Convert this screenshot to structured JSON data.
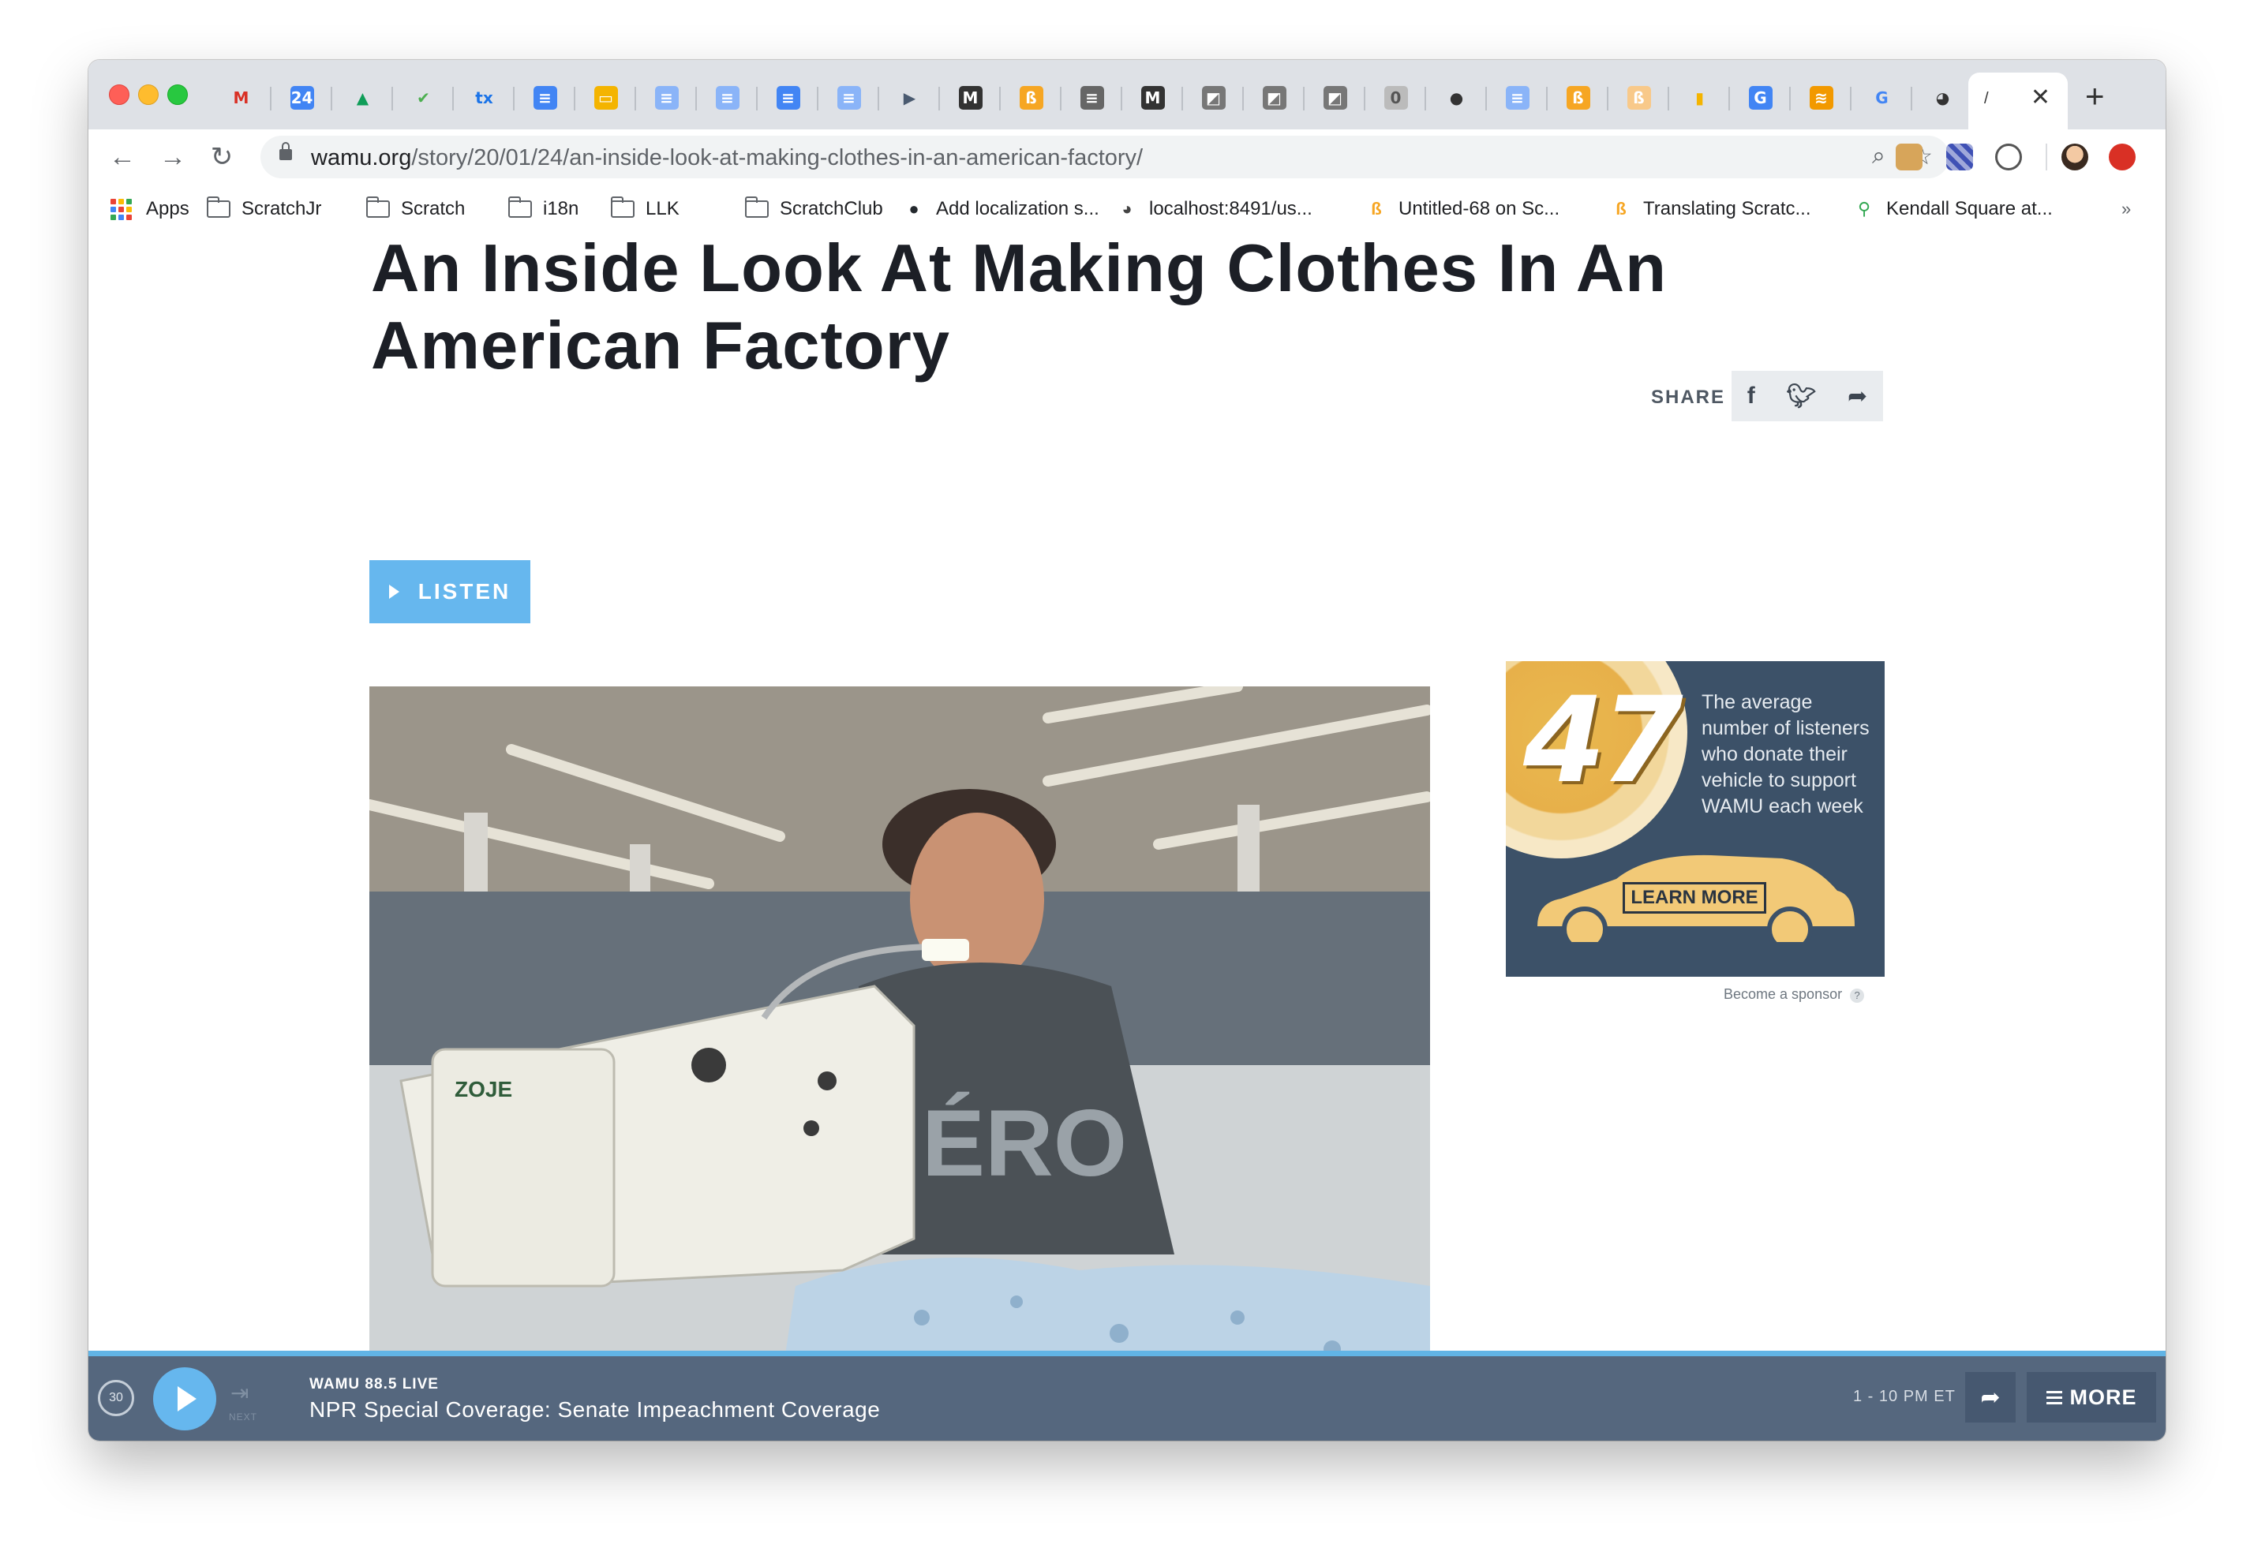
{
  "browser": {
    "tabs": [
      {
        "icon": "gmail-icon",
        "glyph": "M",
        "color": "#d93025",
        "bg": "transparent"
      },
      {
        "icon": "calendar-icon",
        "glyph": "24",
        "color": "#ffffff",
        "bg": "#4285f4"
      },
      {
        "icon": "drive-icon",
        "glyph": "▲",
        "color": "#0f9d58",
        "bg": "transparent"
      },
      {
        "icon": "leaf-icon",
        "glyph": "✔",
        "color": "#4caf50",
        "bg": "transparent"
      },
      {
        "icon": "tx-icon",
        "glyph": "tx",
        "color": "#1a73e8",
        "bg": "transparent"
      },
      {
        "icon": "docs-icon",
        "glyph": "≡",
        "color": "#ffffff",
        "bg": "#4285f4"
      },
      {
        "icon": "slides-icon",
        "glyph": "▭",
        "color": "#ffffff",
        "bg": "#f4b400"
      },
      {
        "icon": "docs-icon",
        "glyph": "≡",
        "color": "#ffffff",
        "bg": "#8ab4f8"
      },
      {
        "icon": "docs-icon",
        "glyph": "≡",
        "color": "#ffffff",
        "bg": "#8ab4f8"
      },
      {
        "icon": "docs-icon",
        "glyph": "≡",
        "color": "#ffffff",
        "bg": "#4285f4"
      },
      {
        "icon": "docs-icon",
        "glyph": "≡",
        "color": "#ffffff",
        "bg": "#8ab4f8"
      },
      {
        "icon": "flag-icon",
        "glyph": "▶",
        "color": "#4a5a70",
        "bg": "transparent"
      },
      {
        "icon": "medium-icon",
        "glyph": "M",
        "color": "#ffffff",
        "bg": "#333333"
      },
      {
        "icon": "scratch-icon",
        "glyph": "ß",
        "color": "#ffffff",
        "bg": "#f6a623"
      },
      {
        "icon": "doc-gray-icon",
        "glyph": "≡",
        "color": "#ffffff",
        "bg": "#666666"
      },
      {
        "icon": "medium-icon",
        "glyph": "M",
        "color": "#ffffff",
        "bg": "#333333"
      },
      {
        "icon": "pencil-icon",
        "glyph": "◩",
        "color": "#ffffff",
        "bg": "#777777"
      },
      {
        "icon": "pencil-icon",
        "glyph": "◩",
        "color": "#ffffff",
        "bg": "#777777"
      },
      {
        "icon": "pencil-icon",
        "glyph": "◩",
        "color": "#ffffff",
        "bg": "#777777"
      },
      {
        "icon": "box-icon",
        "glyph": "0",
        "color": "#555555",
        "bg": "#bbbbbb"
      },
      {
        "icon": "github-icon",
        "glyph": "●",
        "color": "#333333",
        "bg": "transparent"
      },
      {
        "icon": "docs-icon",
        "glyph": "≡",
        "color": "#ffffff",
        "bg": "#8ab4f8"
      },
      {
        "icon": "scratch-icon",
        "glyph": "ß",
        "color": "#ffffff",
        "bg": "#f6a623"
      },
      {
        "icon": "scratch-icon",
        "glyph": "ß",
        "color": "#ffffff",
        "bg": "#f8c98a"
      },
      {
        "icon": "analytics-icon",
        "glyph": "▮",
        "color": "#f4b400",
        "bg": "transparent"
      },
      {
        "icon": "translate-icon",
        "glyph": "G",
        "color": "#ffffff",
        "bg": "#4285f4"
      },
      {
        "icon": "stripes-icon",
        "glyph": "≋",
        "color": "#ffffff",
        "bg": "#f29900"
      },
      {
        "icon": "google-icon",
        "glyph": "G",
        "color": "#4285f4",
        "bg": "transparent"
      },
      {
        "icon": "globe-icon",
        "glyph": "◕",
        "color": "#333333",
        "bg": "transparent"
      }
    ],
    "active_tab_title": "/",
    "url_host": "wamu.org",
    "url_path": "/story/20/01/24/an-inside-look-at-making-clothes-in-an-american-factory/",
    "bookmarks": [
      {
        "label": "Apps",
        "icon": "apps-grid-icon"
      },
      {
        "label": "ScratchJr",
        "icon": "folder-icon"
      },
      {
        "label": "Scratch",
        "icon": "folder-icon"
      },
      {
        "label": "i18n",
        "icon": "folder-icon"
      },
      {
        "label": "LLK",
        "icon": "folder-icon"
      },
      {
        "label": "ScratchClub",
        "icon": "folder-icon"
      },
      {
        "label": "Add localization s...",
        "icon": "github-icon"
      },
      {
        "label": "localhost:8491/us...",
        "icon": "globe-icon"
      },
      {
        "label": "Untitled-68 on Sc...",
        "icon": "scratch-icon"
      },
      {
        "label": "Translating Scratc...",
        "icon": "scratch-icon"
      },
      {
        "label": "Kendall Square at...",
        "icon": "pin-icon"
      }
    ],
    "overflow": "»"
  },
  "article": {
    "headline": "An Inside Look At Making Clothes In An American Factory",
    "share_label": "SHARE",
    "listen_label": "LISTEN"
  },
  "ad": {
    "number": "47",
    "text": "The average number of listeners who donate their vehicle to support WAMU each week",
    "button": "LEARN MORE",
    "sponsor_link": "Become a sponsor",
    "help": "?"
  },
  "player": {
    "rewind_label": "30",
    "next_label": "NEXT",
    "station": "WAMU 88.5 LIVE",
    "program": "NPR Special Coverage: Senate Impeachment Coverage",
    "time": "1 - 10 PM ET",
    "more_label": "MORE"
  }
}
